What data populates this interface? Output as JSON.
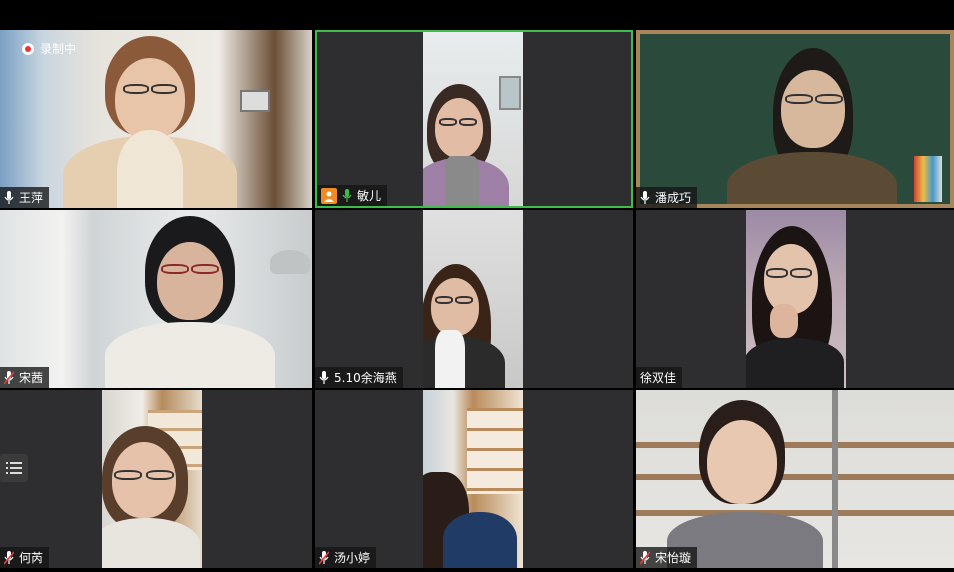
{
  "recording": {
    "label": "录制中"
  },
  "participants": [
    {
      "name": "王萍",
      "mic": "on"
    },
    {
      "name": "敏儿",
      "mic": "speaking"
    },
    {
      "name": "潘成巧",
      "mic": "on"
    },
    {
      "name": "宋茜",
      "mic": "muted"
    },
    {
      "name": "5.10余海燕",
      "mic": "on"
    },
    {
      "name": "徐双佳",
      "mic": "none"
    },
    {
      "name": "何芮",
      "mic": "muted"
    },
    {
      "name": "汤小婷",
      "mic": "muted"
    },
    {
      "name": "宋怡璇",
      "mic": "muted"
    }
  ],
  "colors": {
    "active_border": "#3dbe4a",
    "speaking_mic": "#3dbe4a",
    "muted_mic": "#e04040",
    "tile_bg": "#2e2e30"
  },
  "icons": {
    "mic": "microphone-icon",
    "muted": "microphone-muted-icon",
    "record": "record-icon",
    "list": "list-icon",
    "avatar": "avatar-icon"
  }
}
